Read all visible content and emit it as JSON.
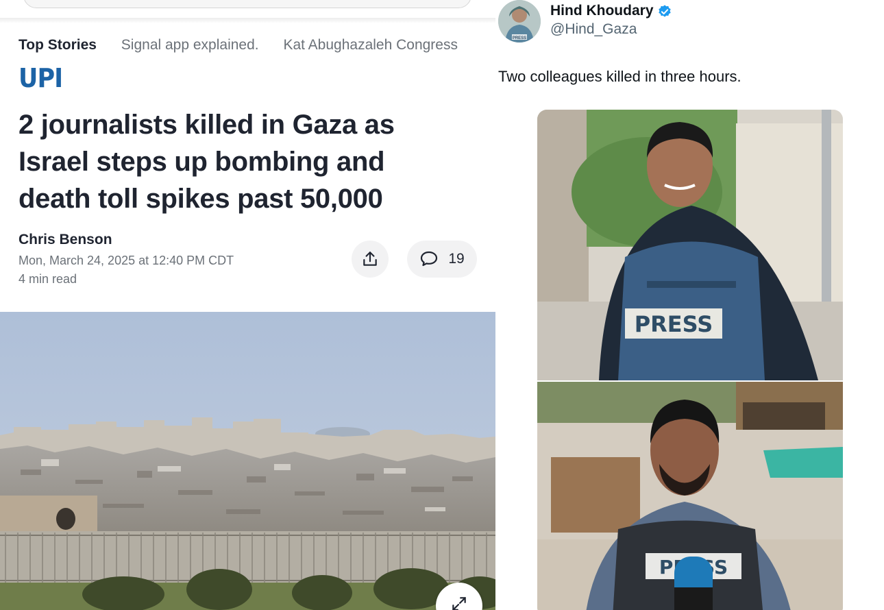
{
  "article": {
    "top_stories": {
      "title": "Top Stories",
      "links": [
        "Signal app explained.",
        "Kat Abughazaleh Congress"
      ]
    },
    "publisher": "UPI",
    "headline": "2 journalists killed in Gaza as Israel steps up bombing and death toll spikes past 50,000",
    "author": "Chris Benson",
    "date": "Mon, March 24, 2025 at 12:40 PM CDT",
    "read_time": "4 min read",
    "share_icon": "share-icon",
    "comment_icon": "comment-icon",
    "comment_count": "19",
    "expand_icon": "expand-icon"
  },
  "tweet": {
    "display_name": "Hind Khoudary",
    "verified": true,
    "handle": "@Hind_Gaza",
    "avatar_badge": "PRESS",
    "text": "Two colleagues killed in three hours.",
    "media": [
      {
        "vest_label": "PRESS"
      },
      {
        "vest_label": "PRESS"
      }
    ]
  },
  "colors": {
    "upi_blue": "#1c63a6",
    "verified_blue": "#1d9bf0",
    "headline_text": "#1f2430",
    "muted_text": "#6b7178",
    "press_vest": "#3b5f86"
  }
}
